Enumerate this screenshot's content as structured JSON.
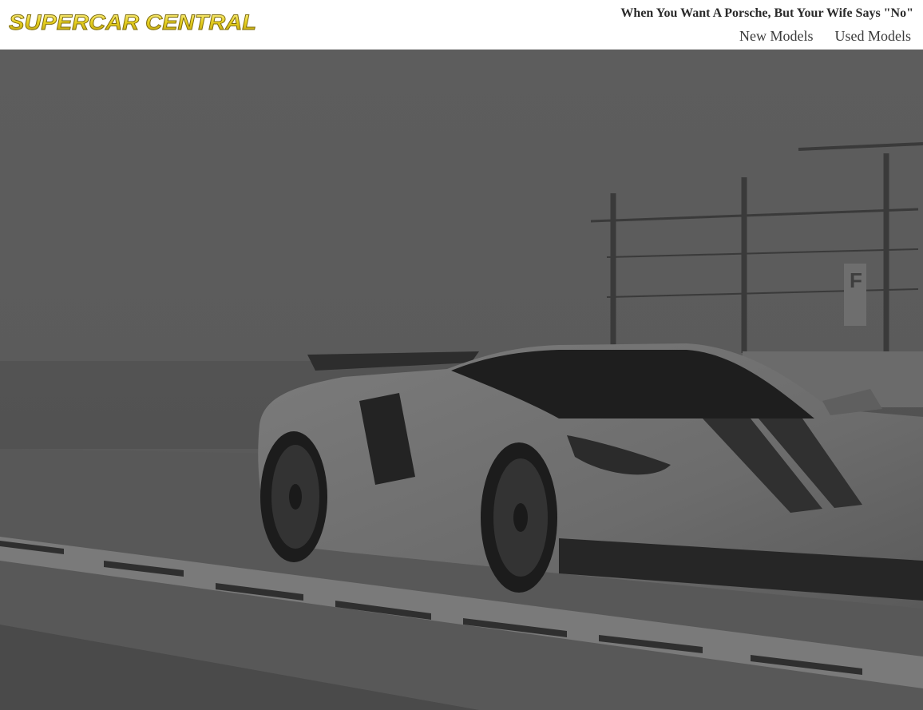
{
  "brand": {
    "logo_text": "SUPERCAR CENTRAL"
  },
  "header": {
    "tagline": "When You Want A Porsche, But Your Wife Says \"No\""
  },
  "nav": {
    "items": [
      "New Models",
      "Used Models"
    ]
  },
  "hero": {
    "subject": "race car on track",
    "tint": "dark grayscale overlay"
  },
  "colors": {
    "logo_fill": "#e8d52a",
    "logo_stroke": "#8a7a10",
    "header_bg": "#ffffff",
    "overlay": "#555555"
  }
}
